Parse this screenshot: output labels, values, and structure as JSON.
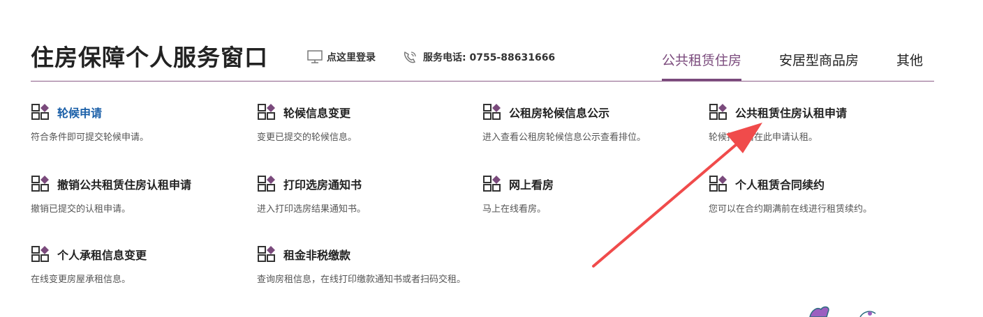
{
  "header": {
    "title": "住房保障个人服务窗口",
    "login_label": "点这里登录",
    "phone_label": "服务电话: 0755-88631666",
    "tabs": [
      {
        "label": "公共租赁住房",
        "active": true
      },
      {
        "label": "安居型商品房",
        "active": false
      },
      {
        "label": "其他",
        "active": false
      }
    ]
  },
  "services": [
    {
      "title": "轮候申请",
      "desc": "符合条件即可提交轮候申请。"
    },
    {
      "title": "轮候信息变更",
      "desc": "变更已提交的轮候信息。"
    },
    {
      "title": "公租房轮候信息公示",
      "desc": "进入查看公租房轮候信息公示查看排位。"
    },
    {
      "title": "公共租赁住房认租申请",
      "desc": "轮候排位后在此申请认租。"
    },
    {
      "title": "撤销公共租赁住房认租申请",
      "desc": "撤销已提交的认租申请。"
    },
    {
      "title": "打印选房通知书",
      "desc": "进入打印选房结果通知书。"
    },
    {
      "title": "网上看房",
      "desc": "马上在线看房。"
    },
    {
      "title": "个人租赁合同续约",
      "desc": "您可以在合约期满前在线进行租赁续约。"
    },
    {
      "title": "个人承租信息变更",
      "desc": "在线变更房屋承租信息。"
    },
    {
      "title": "租金非税缴款",
      "desc": "查询房租信息，在线打印缴款通知书或者扫码交租。"
    }
  ],
  "colors": {
    "accent": "#7a4a7c",
    "link_blue": "#1a5fa8",
    "arrow": "#f04b4b",
    "icon_diamond": "#7a4a7c"
  },
  "icons": {
    "login": "monitor-icon",
    "phone": "phone-icon",
    "service": "grid-diamond-icon"
  }
}
